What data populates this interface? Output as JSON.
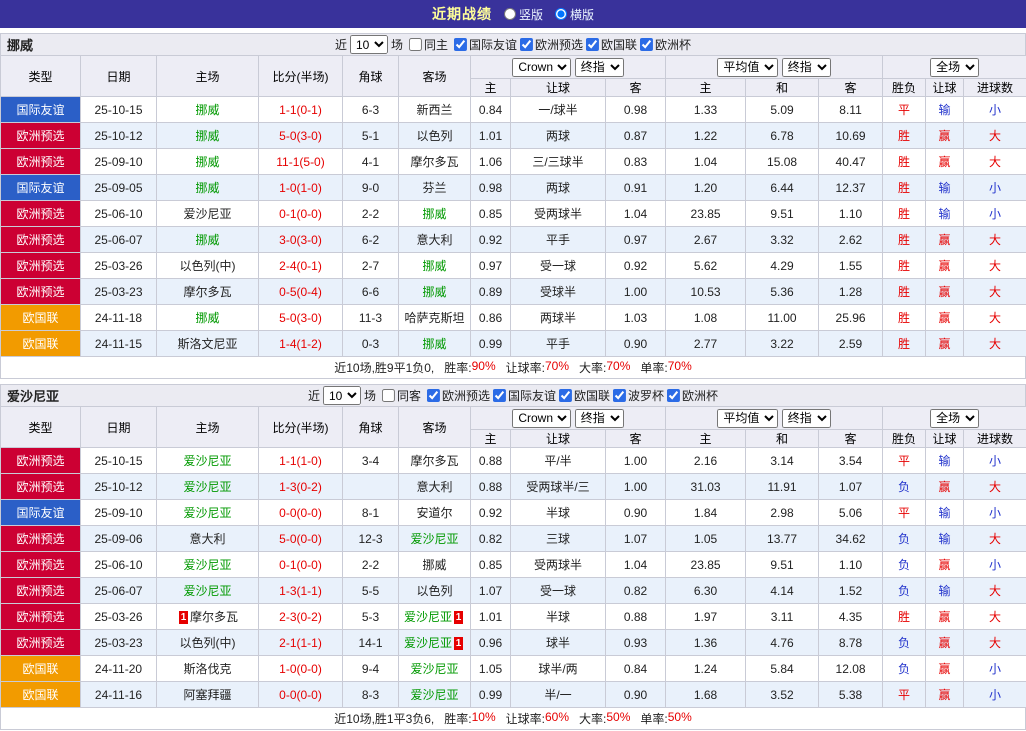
{
  "topbar": {
    "title": "近期战绩",
    "vertical": "竖版",
    "horizontal": "横版",
    "selected_index": 1
  },
  "labels": {
    "near": "近",
    "games_suffix": "场"
  },
  "selects": {
    "bookmaker": "Crown",
    "final_index": "终指",
    "average": "平均值",
    "full_match": "全场"
  },
  "header": {
    "cols": [
      "类型",
      "日期",
      "主场",
      "比分(半场)",
      "角球",
      "客场"
    ],
    "sub": [
      "主",
      "让球",
      "客",
      "主",
      "和",
      "客",
      "胜负",
      "让球",
      "进球数"
    ]
  },
  "colors": {
    "topbar_bg": "#39329b",
    "team_green": "#009900",
    "score_red": "#e60000",
    "result_red": "#e60000",
    "result_blue": "#2233cc",
    "type": {
      "国际友谊": "#2b5fc7",
      "欧洲预选": "#cc0033",
      "欧国联": "#f29b00"
    }
  },
  "sections": [
    {
      "team": "挪威",
      "games": "10",
      "same_label": "同主",
      "same_checked": false,
      "filters": [
        "国际友谊",
        "欧洲预选",
        "欧国联",
        "欧洲杯"
      ],
      "rows": [
        {
          "type": "国际友谊",
          "date": "25-10-15",
          "home": "挪威",
          "hg": true,
          "hb": "",
          "score": "1-1(0-1)",
          "corners": "6-3",
          "away": "新西兰",
          "ag": false,
          "ab": "",
          "o": [
            "0.84",
            "一/球半",
            "0.98"
          ],
          "avg": [
            "1.33",
            "5.09",
            "8.11"
          ],
          "res": [
            "平",
            "输",
            "小"
          ],
          "rc": [
            "r",
            "b",
            "b"
          ]
        },
        {
          "type": "欧洲预选",
          "date": "25-10-12",
          "home": "挪威",
          "hg": true,
          "hb": "",
          "score": "5-0(3-0)",
          "corners": "5-1",
          "away": "以色列",
          "ag": false,
          "ab": "",
          "o": [
            "1.01",
            "两球",
            "0.87"
          ],
          "avg": [
            "1.22",
            "6.78",
            "10.69"
          ],
          "res": [
            "胜",
            "赢",
            "大"
          ],
          "rc": [
            "r",
            "r",
            "r"
          ]
        },
        {
          "type": "欧洲预选",
          "date": "25-09-10",
          "home": "挪威",
          "hg": true,
          "hb": "",
          "score": "11-1(5-0)",
          "corners": "4-1",
          "away": "摩尔多瓦",
          "ag": false,
          "ab": "",
          "o": [
            "1.06",
            "三/三球半",
            "0.83"
          ],
          "avg": [
            "1.04",
            "15.08",
            "40.47"
          ],
          "res": [
            "胜",
            "赢",
            "大"
          ],
          "rc": [
            "r",
            "r",
            "r"
          ]
        },
        {
          "type": "国际友谊",
          "date": "25-09-05",
          "home": "挪威",
          "hg": true,
          "hb": "",
          "score": "1-0(1-0)",
          "corners": "9-0",
          "away": "芬兰",
          "ag": false,
          "ab": "",
          "o": [
            "0.98",
            "两球",
            "0.91"
          ],
          "avg": [
            "1.20",
            "6.44",
            "12.37"
          ],
          "res": [
            "胜",
            "输",
            "小"
          ],
          "rc": [
            "r",
            "b",
            "b"
          ]
        },
        {
          "type": "欧洲预选",
          "date": "25-06-10",
          "home": "爱沙尼亚",
          "hg": false,
          "hb": "",
          "score": "0-1(0-0)",
          "corners": "2-2",
          "away": "挪威",
          "ag": true,
          "ab": "",
          "o": [
            "0.85",
            "受两球半",
            "1.04"
          ],
          "avg": [
            "23.85",
            "9.51",
            "1.10"
          ],
          "res": [
            "胜",
            "输",
            "小"
          ],
          "rc": [
            "r",
            "b",
            "b"
          ]
        },
        {
          "type": "欧洲预选",
          "date": "25-06-07",
          "home": "挪威",
          "hg": true,
          "hb": "",
          "score": "3-0(3-0)",
          "corners": "6-2",
          "away": "意大利",
          "ag": false,
          "ab": "",
          "o": [
            "0.92",
            "平手",
            "0.97"
          ],
          "avg": [
            "2.67",
            "3.32",
            "2.62"
          ],
          "res": [
            "胜",
            "赢",
            "大"
          ],
          "rc": [
            "r",
            "r",
            "r"
          ]
        },
        {
          "type": "欧洲预选",
          "date": "25-03-26",
          "home": "以色列(中)",
          "hg": false,
          "hb": "",
          "score": "2-4(0-1)",
          "corners": "2-7",
          "away": "挪威",
          "ag": true,
          "ab": "",
          "o": [
            "0.97",
            "受一球",
            "0.92"
          ],
          "avg": [
            "5.62",
            "4.29",
            "1.55"
          ],
          "res": [
            "胜",
            "赢",
            "大"
          ],
          "rc": [
            "r",
            "r",
            "r"
          ]
        },
        {
          "type": "欧洲预选",
          "date": "25-03-23",
          "home": "摩尔多瓦",
          "hg": false,
          "hb": "",
          "score": "0-5(0-4)",
          "corners": "6-6",
          "away": "挪威",
          "ag": true,
          "ab": "",
          "o": [
            "0.89",
            "受球半",
            "1.00"
          ],
          "avg": [
            "10.53",
            "5.36",
            "1.28"
          ],
          "res": [
            "胜",
            "赢",
            "大"
          ],
          "rc": [
            "r",
            "r",
            "r"
          ]
        },
        {
          "type": "欧国联",
          "date": "24-11-18",
          "home": "挪威",
          "hg": true,
          "hb": "",
          "score": "5-0(3-0)",
          "corners": "11-3",
          "away": "哈萨克斯坦",
          "ag": false,
          "ab": "",
          "o": [
            "0.86",
            "两球半",
            "1.03"
          ],
          "avg": [
            "1.08",
            "11.00",
            "25.96"
          ],
          "res": [
            "胜",
            "赢",
            "大"
          ],
          "rc": [
            "r",
            "r",
            "r"
          ]
        },
        {
          "type": "欧国联",
          "date": "24-11-15",
          "home": "斯洛文尼亚",
          "hg": false,
          "hb": "",
          "score": "1-4(1-2)",
          "corners": "0-3",
          "away": "挪威",
          "ag": true,
          "ab": "",
          "o": [
            "0.99",
            "平手",
            "0.90"
          ],
          "avg": [
            "2.77",
            "3.22",
            "2.59"
          ],
          "res": [
            "胜",
            "赢",
            "大"
          ],
          "rc": [
            "r",
            "r",
            "r"
          ]
        }
      ],
      "summary": {
        "record": "近10场,胜9平1负0,",
        "stats": [
          [
            "胜率:",
            "90%"
          ],
          [
            "让球率:",
            "70%"
          ],
          [
            "大率:",
            "70%"
          ],
          [
            "单率:",
            "70%"
          ]
        ]
      }
    },
    {
      "team": "爱沙尼亚",
      "games": "10",
      "same_label": "同客",
      "same_checked": false,
      "filters": [
        "欧洲预选",
        "国际友谊",
        "欧国联",
        "波罗杯",
        "欧洲杯"
      ],
      "rows": [
        {
          "type": "欧洲预选",
          "date": "25-10-15",
          "home": "爱沙尼亚",
          "hg": true,
          "hb": "",
          "score": "1-1(1-0)",
          "corners": "3-4",
          "away": "摩尔多瓦",
          "ag": false,
          "ab": "",
          "o": [
            "0.88",
            "平/半",
            "1.00"
          ],
          "avg": [
            "2.16",
            "3.14",
            "3.54"
          ],
          "res": [
            "平",
            "输",
            "小"
          ],
          "rc": [
            "r",
            "b",
            "b"
          ]
        },
        {
          "type": "欧洲预选",
          "date": "25-10-12",
          "home": "爱沙尼亚",
          "hg": true,
          "hb": "",
          "score": "1-3(0-2)",
          "corners": "",
          "away": "意大利",
          "ag": false,
          "ab": "",
          "o": [
            "0.88",
            "受两球半/三",
            "1.00"
          ],
          "avg": [
            "31.03",
            "11.91",
            "1.07"
          ],
          "res": [
            "负",
            "赢",
            "大"
          ],
          "rc": [
            "b",
            "r",
            "r"
          ]
        },
        {
          "type": "国际友谊",
          "date": "25-09-10",
          "home": "爱沙尼亚",
          "hg": true,
          "hb": "",
          "score": "0-0(0-0)",
          "corners": "8-1",
          "away": "安道尔",
          "ag": false,
          "ab": "",
          "o": [
            "0.92",
            "半球",
            "0.90"
          ],
          "avg": [
            "1.84",
            "2.98",
            "5.06"
          ],
          "res": [
            "平",
            "输",
            "小"
          ],
          "rc": [
            "r",
            "b",
            "b"
          ]
        },
        {
          "type": "欧洲预选",
          "date": "25-09-06",
          "home": "意大利",
          "hg": false,
          "hb": "",
          "score": "5-0(0-0)",
          "corners": "12-3",
          "away": "爱沙尼亚",
          "ag": true,
          "ab": "",
          "o": [
            "0.82",
            "三球",
            "1.07"
          ],
          "avg": [
            "1.05",
            "13.77",
            "34.62"
          ],
          "res": [
            "负",
            "输",
            "大"
          ],
          "rc": [
            "b",
            "b",
            "r"
          ]
        },
        {
          "type": "欧洲预选",
          "date": "25-06-10",
          "home": "爱沙尼亚",
          "hg": true,
          "hb": "",
          "score": "0-1(0-0)",
          "corners": "2-2",
          "away": "挪威",
          "ag": false,
          "ab": "",
          "o": [
            "0.85",
            "受两球半",
            "1.04"
          ],
          "avg": [
            "23.85",
            "9.51",
            "1.10"
          ],
          "res": [
            "负",
            "赢",
            "小"
          ],
          "rc": [
            "b",
            "r",
            "b"
          ]
        },
        {
          "type": "欧洲预选",
          "date": "25-06-07",
          "home": "爱沙尼亚",
          "hg": true,
          "hb": "",
          "score": "1-3(1-1)",
          "corners": "5-5",
          "away": "以色列",
          "ag": false,
          "ab": "",
          "o": [
            "1.07",
            "受一球",
            "0.82"
          ],
          "avg": [
            "6.30",
            "4.14",
            "1.52"
          ],
          "res": [
            "负",
            "输",
            "大"
          ],
          "rc": [
            "b",
            "b",
            "r"
          ]
        },
        {
          "type": "欧洲预选",
          "date": "25-03-26",
          "home": "摩尔多瓦",
          "hg": false,
          "hb": "1",
          "score": "2-3(0-2)",
          "corners": "5-3",
          "away": "爱沙尼亚",
          "ag": true,
          "ab": "1",
          "o": [
            "1.01",
            "半球",
            "0.88"
          ],
          "avg": [
            "1.97",
            "3.11",
            "4.35"
          ],
          "res": [
            "胜",
            "赢",
            "大"
          ],
          "rc": [
            "r",
            "r",
            "r"
          ]
        },
        {
          "type": "欧洲预选",
          "date": "25-03-23",
          "home": "以色列(中)",
          "hg": false,
          "hb": "",
          "score": "2-1(1-1)",
          "corners": "14-1",
          "away": "爱沙尼亚",
          "ag": true,
          "ab": "1",
          "o": [
            "0.96",
            "球半",
            "0.93"
          ],
          "avg": [
            "1.36",
            "4.76",
            "8.78"
          ],
          "res": [
            "负",
            "赢",
            "大"
          ],
          "rc": [
            "b",
            "r",
            "r"
          ]
        },
        {
          "type": "欧国联",
          "date": "24-11-20",
          "home": "斯洛伐克",
          "hg": false,
          "hb": "",
          "score": "1-0(0-0)",
          "corners": "9-4",
          "away": "爱沙尼亚",
          "ag": true,
          "ab": "",
          "o": [
            "1.05",
            "球半/两",
            "0.84"
          ],
          "avg": [
            "1.24",
            "5.84",
            "12.08"
          ],
          "res": [
            "负",
            "赢",
            "小"
          ],
          "rc": [
            "b",
            "r",
            "b"
          ]
        },
        {
          "type": "欧国联",
          "date": "24-11-16",
          "home": "阿塞拜疆",
          "hg": false,
          "hb": "",
          "score": "0-0(0-0)",
          "corners": "8-3",
          "away": "爱沙尼亚",
          "ag": true,
          "ab": "",
          "o": [
            "0.99",
            "半/一",
            "0.90"
          ],
          "avg": [
            "1.68",
            "3.52",
            "5.38"
          ],
          "res": [
            "平",
            "赢",
            "小"
          ],
          "rc": [
            "r",
            "r",
            "b"
          ]
        }
      ],
      "summary": {
        "record": "近10场,胜1平3负6,",
        "stats": [
          [
            "胜率:",
            "10%"
          ],
          [
            "让球率:",
            "60%"
          ],
          [
            "大率:",
            "50%"
          ],
          [
            "单率:",
            "50%"
          ]
        ]
      }
    }
  ]
}
